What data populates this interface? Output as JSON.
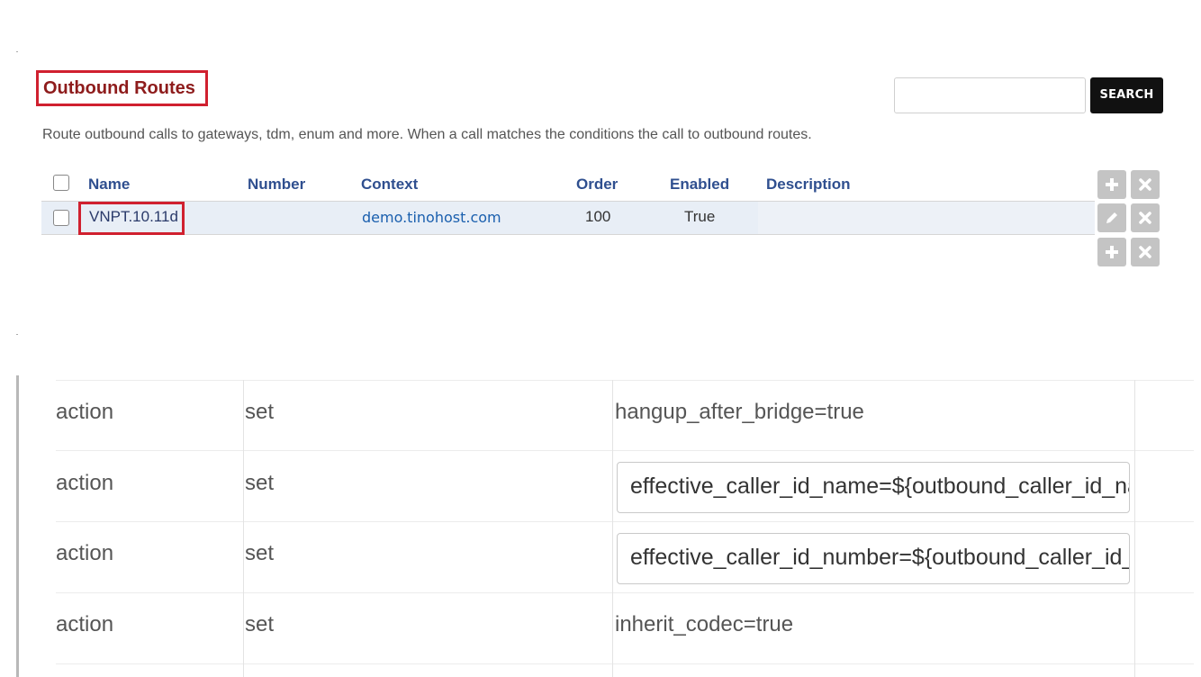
{
  "header": {
    "title": "Outbound Routes",
    "description": "Route outbound calls to gateways, tdm, enum and more. When a call matches the conditions the call to outbound routes."
  },
  "search": {
    "value": "",
    "placeholder": "",
    "button_label": "SEARCH"
  },
  "table": {
    "columns": [
      "Name",
      "Number",
      "Context",
      "Order",
      "Enabled",
      "Description"
    ],
    "rows": [
      {
        "name": "VNPT.10.11d",
        "number": "",
        "context": "demo.tinohost.com",
        "order": "100",
        "enabled": "True",
        "description": ""
      }
    ]
  },
  "actions": [
    {
      "type": "action",
      "application": "set",
      "data": "hangup_after_bridge=true",
      "editable": false
    },
    {
      "type": "action",
      "application": "set",
      "data": "effective_caller_id_name=${outbound_caller_id_name}",
      "editable": true
    },
    {
      "type": "action",
      "application": "set",
      "data": "effective_caller_id_number=${outbound_caller_id_number}",
      "editable": true
    },
    {
      "type": "action",
      "application": "set",
      "data": "inherit_codec=true",
      "editable": false
    }
  ],
  "icons": {
    "add": "plus-icon",
    "delete": "x-icon",
    "edit": "pencil-icon"
  },
  "colors": {
    "title": "#8e1c1c",
    "highlight_border": "#d0202f",
    "header_text": "#2f4f8f",
    "link": "#1a5fae",
    "search_button": "#111111",
    "icon_button": "#c4c4c4"
  }
}
